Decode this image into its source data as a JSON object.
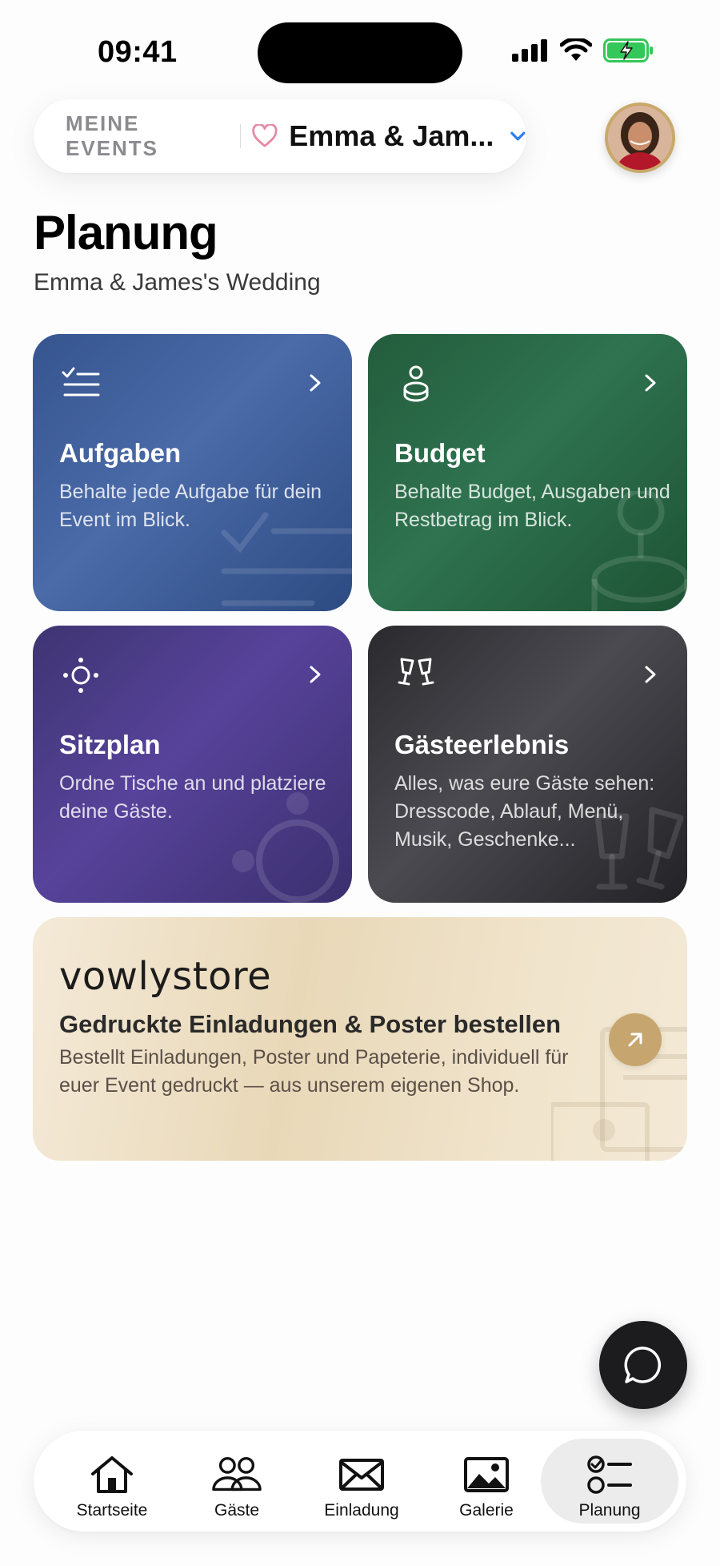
{
  "status_bar": {
    "time": "09:41"
  },
  "event_selector": {
    "label": "MEINE EVENTS",
    "event_name": "Emma & Jam..."
  },
  "header": {
    "title": "Planung",
    "subtitle": "Emma & James's Wedding"
  },
  "cards": [
    {
      "title": "Aufgaben",
      "description": "Behalte jede Aufgabe für dein Event im Blick.",
      "icon": "checklist-icon",
      "color": "#3f5f9c"
    },
    {
      "title": "Budget",
      "description": "Behalte Budget, Ausgaben und Restbetrag im Blick.",
      "icon": "coins-icon",
      "color": "#2a6a47"
    },
    {
      "title": "Sitzplan",
      "description": "Ordne Tische an und platziere deine Gäste.",
      "icon": "table-seating-icon",
      "color": "#4d3d8c"
    },
    {
      "title": "Gästeerlebnis",
      "description": "Alles, was eure Gäste sehen: Dresscode, Ablauf, Menü, Musik, Geschenke...",
      "icon": "champagne-glasses-icon",
      "color": "#38383d"
    }
  ],
  "store": {
    "logo": "vowlystore",
    "title": "Gedruckte Einladungen & Poster bestellen",
    "description": "Bestellt Einladungen, Poster und Papeterie, individuell für euer Event gedruckt — aus unserem eigenen Shop.",
    "accent": "#c6a66e"
  },
  "tabs": [
    {
      "label": "Startseite",
      "icon": "home-icon"
    },
    {
      "label": "Gäste",
      "icon": "people-icon"
    },
    {
      "label": "Einladung",
      "icon": "envelope-icon"
    },
    {
      "label": "Galerie",
      "icon": "image-icon"
    },
    {
      "label": "Planung",
      "icon": "checklist-icon",
      "active": true
    }
  ],
  "colors": {
    "accent_blue": "#2f7cf6",
    "heart_pink": "#e58aa6",
    "battery_green": "#34c759"
  }
}
